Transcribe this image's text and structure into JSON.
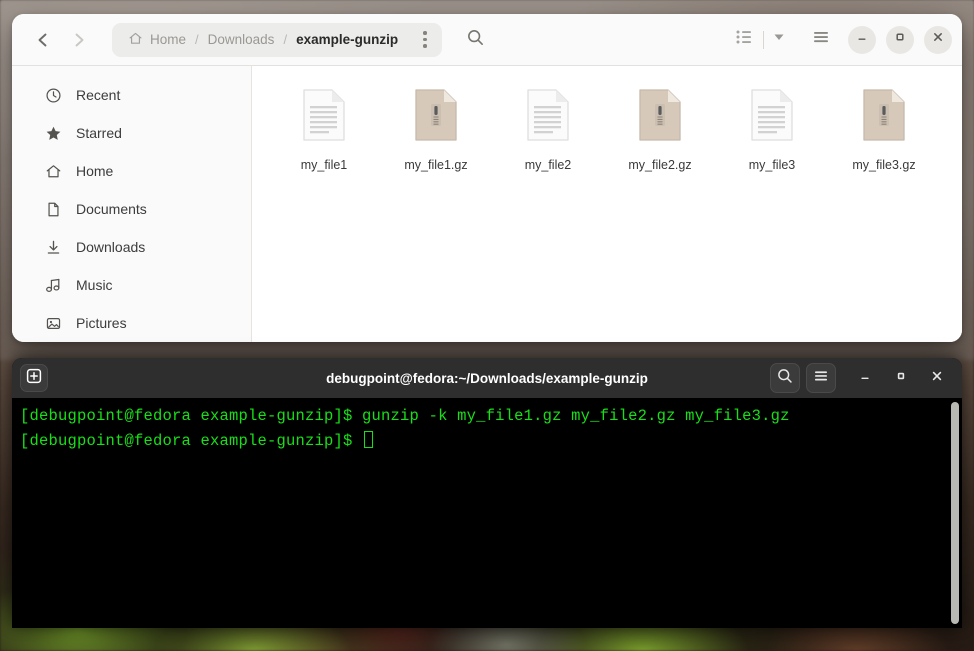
{
  "filemanager": {
    "nav": {
      "back_label": "Back",
      "back_icon": "chevron-left-icon",
      "forward_label": "Forward",
      "forward_icon": "chevron-right-icon"
    },
    "breadcrumb": {
      "home_icon": "home-icon",
      "items": [
        {
          "label": "Home",
          "current": false
        },
        {
          "label": "Downloads",
          "current": false
        },
        {
          "label": "example-gunzip",
          "current": true
        }
      ],
      "separator": "/",
      "menu_icon": "vertical-dots-icon"
    },
    "toolbar": {
      "search_icon": "search-icon",
      "view_list_icon": "list-view-icon",
      "view_dropdown_icon": "chevron-down-icon",
      "main_menu_icon": "hamburger-menu-icon"
    },
    "window_controls": {
      "minimize": "minimize-icon",
      "maximize": "maximize-icon",
      "close": "close-icon"
    },
    "sidebar": {
      "items": [
        {
          "label": "Recent",
          "icon": "clock-icon"
        },
        {
          "label": "Starred",
          "icon": "star-icon"
        },
        {
          "label": "Home",
          "icon": "home-icon"
        },
        {
          "label": "Documents",
          "icon": "document-icon"
        },
        {
          "label": "Downloads",
          "icon": "download-arrow-icon"
        },
        {
          "label": "Music",
          "icon": "music-note-icon"
        },
        {
          "label": "Pictures",
          "icon": "image-icon"
        }
      ]
    },
    "files": [
      {
        "name": "my_file1",
        "type": "text"
      },
      {
        "name": "my_file1.gz",
        "type": "archive"
      },
      {
        "name": "my_file2",
        "type": "text"
      },
      {
        "name": "my_file2.gz",
        "type": "archive"
      },
      {
        "name": "my_file3",
        "type": "text"
      },
      {
        "name": "my_file3.gz",
        "type": "archive"
      }
    ]
  },
  "terminal": {
    "title": "debugpoint@fedora:~/Downloads/example-gunzip",
    "new_tab_icon": "plus-in-box-icon",
    "search_icon": "search-icon",
    "menu_icon": "hamburger-menu-icon",
    "window_controls": {
      "minimize": "minimize-icon",
      "maximize": "maximize-icon",
      "close": "close-icon"
    },
    "lines": [
      "[debugpoint@fedora example-gunzip]$ gunzip -k my_file1.gz my_file2.gz my_file3.gz",
      "[debugpoint@fedora example-gunzip]$ "
    ],
    "prompt_text": "[debugpoint@fedora example-gunzip]$ ",
    "text_color": "#18e018",
    "background_color": "#000000"
  }
}
